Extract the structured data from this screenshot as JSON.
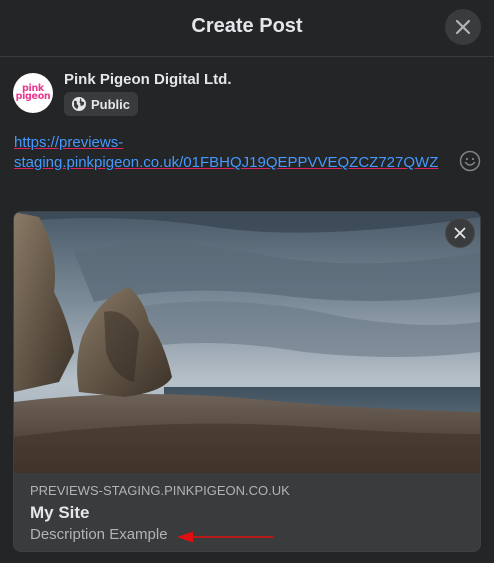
{
  "dialog": {
    "title": "Create Post",
    "close_icon": "close-icon"
  },
  "author": {
    "name": "Pink Pigeon Digital Ltd.",
    "avatar_text_line1": "pink",
    "avatar_text_line2": "pigeon",
    "audience_label": "Public",
    "audience_icon": "globe-icon"
  },
  "post": {
    "text": "https://previews-staging.pinkpigeon.co.uk/01FBHQJ19QEPPVVEQZCZ727QWZ",
    "emoji_icon": "smiley-icon"
  },
  "link_preview": {
    "domain": "PREVIEWS-STAGING.PINKPIGEON.CO.UK",
    "title": "My Site",
    "description": "Description Example",
    "image_icon": "coastal-landscape-image"
  },
  "colors": {
    "background": "#242526",
    "card": "#3a3b3c",
    "link": "#4599ff",
    "annotation_arrow": "#e01010",
    "brand_pink": "#e8398f"
  }
}
